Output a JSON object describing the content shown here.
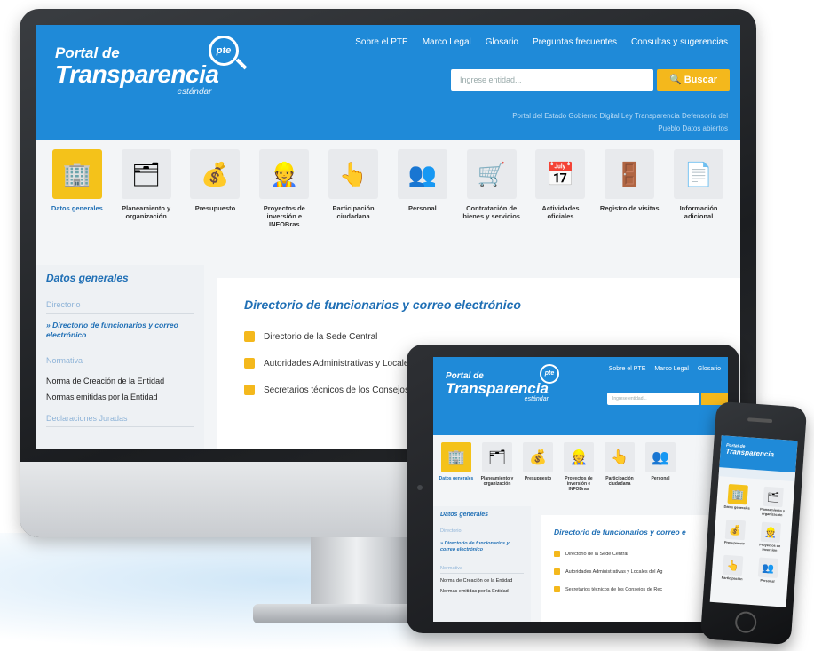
{
  "desktop": {
    "logo": {
      "line1": "Portal de",
      "line2": "Transparencia",
      "line3": "estándar",
      "badge": "pte"
    },
    "topnav": [
      "Sobre el PTE",
      "Marco Legal",
      "Glosario",
      "Preguntas frecuentes",
      "Consultas y sugerencias"
    ],
    "search": {
      "placeholder": "Ingrese entidad...",
      "button": "Buscar"
    },
    "sublinks": "Portal del Estado   Gobierno Digital   Ley Transparencia   Defensoría del Pueblo   Datos abiertos",
    "categories": [
      {
        "label": "Datos generales",
        "icon": "🏢",
        "icon_name": "building-icon",
        "active": true
      },
      {
        "label": "Planeamiento y organización",
        "icon": "🗂",
        "icon_name": "org-chart-icon",
        "active": false
      },
      {
        "label": "Presupuesto",
        "icon": "💰",
        "icon_name": "money-bag-icon",
        "active": false
      },
      {
        "label": "Proyectos de inversión e INFOBras",
        "icon": "👷",
        "icon_name": "worker-icon",
        "active": false
      },
      {
        "label": "Participación ciudadana",
        "icon": "👆",
        "icon_name": "hand-icon",
        "active": false
      },
      {
        "label": "Personal",
        "icon": "👥",
        "icon_name": "people-icon",
        "active": false
      },
      {
        "label": "Contratación de bienes y servicios",
        "icon": "🛒",
        "icon_name": "cart-icon",
        "active": false
      },
      {
        "label": "Actividades oficiales",
        "icon": "📅",
        "icon_name": "calendar-icon",
        "active": false
      },
      {
        "label": "Registro de visitas",
        "icon": "🚪",
        "icon_name": "visitor-icon",
        "active": false
      },
      {
        "label": "Información adicional",
        "icon": "📄",
        "icon_name": "document-icon",
        "active": false
      }
    ],
    "sidebar": {
      "title": "Datos generales",
      "section1": "Directorio",
      "active_link": "» Directorio de funcionarios y correo electrónico",
      "section2": "Normativa",
      "items": [
        "Norma de Creación de la Entidad",
        "Normas emitidas por la Entidad"
      ],
      "section3": "Declaraciones Juradas"
    },
    "content": {
      "title": "Directorio de funcionarios y correo electrónico",
      "rows": [
        "Directorio de la Sede Central",
        "Autoridades Administrativas y Locales",
        "Secretarios técnicos de los Consejos"
      ]
    }
  },
  "tablet": {
    "logo": {
      "line1": "Portal de",
      "line2": "Transparencia",
      "line3": "estándar",
      "badge": "pte"
    },
    "topnav": [
      "Sobre el PTE",
      "Marco Legal",
      "Glosario"
    ],
    "categories": [
      {
        "label": "Datos generales",
        "icon": "🏢",
        "active": true
      },
      {
        "label": "Planeamiento y organización",
        "icon": "🗂",
        "active": false
      },
      {
        "label": "Presupuesto",
        "icon": "💰",
        "active": false
      },
      {
        "label": "Proyectos de inversión e INFOBras",
        "icon": "👷",
        "active": false
      },
      {
        "label": "Participación ciudadana",
        "icon": "👆",
        "active": false
      },
      {
        "label": "Personal",
        "icon": "👥",
        "active": false
      }
    ],
    "sidebar": {
      "title": "Datos generales",
      "section1": "Directorio",
      "active_link": "» Directorio de funcionarios y correo electrónico",
      "section2": "Normativa",
      "items": [
        "Norma de Creación de la Entidad",
        "Normas emitidas por la Entidad"
      ]
    },
    "content": {
      "title": "Directorio de funcionarios y correo e",
      "rows": [
        "Directorio de la Sede Central",
        "Autoridades Administrativas y Locales del Ag",
        "Secretarios técnicos de los Consejos de Rec"
      ]
    }
  },
  "phone": {
    "logo": {
      "line1": "Portal de",
      "line2": "Transparencia"
    },
    "categories": [
      {
        "label": "Datos generales",
        "icon": "🏢",
        "active": true
      },
      {
        "label": "Planeamiento y organización",
        "icon": "🗂",
        "active": false
      },
      {
        "label": "Presupuesto",
        "icon": "💰",
        "active": false
      },
      {
        "label": "Proyectos de inversión",
        "icon": "👷",
        "active": false
      },
      {
        "label": "Participación",
        "icon": "👆",
        "active": false
      },
      {
        "label": "Personal",
        "icon": "👥",
        "active": false
      }
    ]
  },
  "colors": {
    "brand_blue": "#1f8ad8",
    "accent_yellow": "#f4b81c",
    "link_blue": "#1f6fb5"
  }
}
